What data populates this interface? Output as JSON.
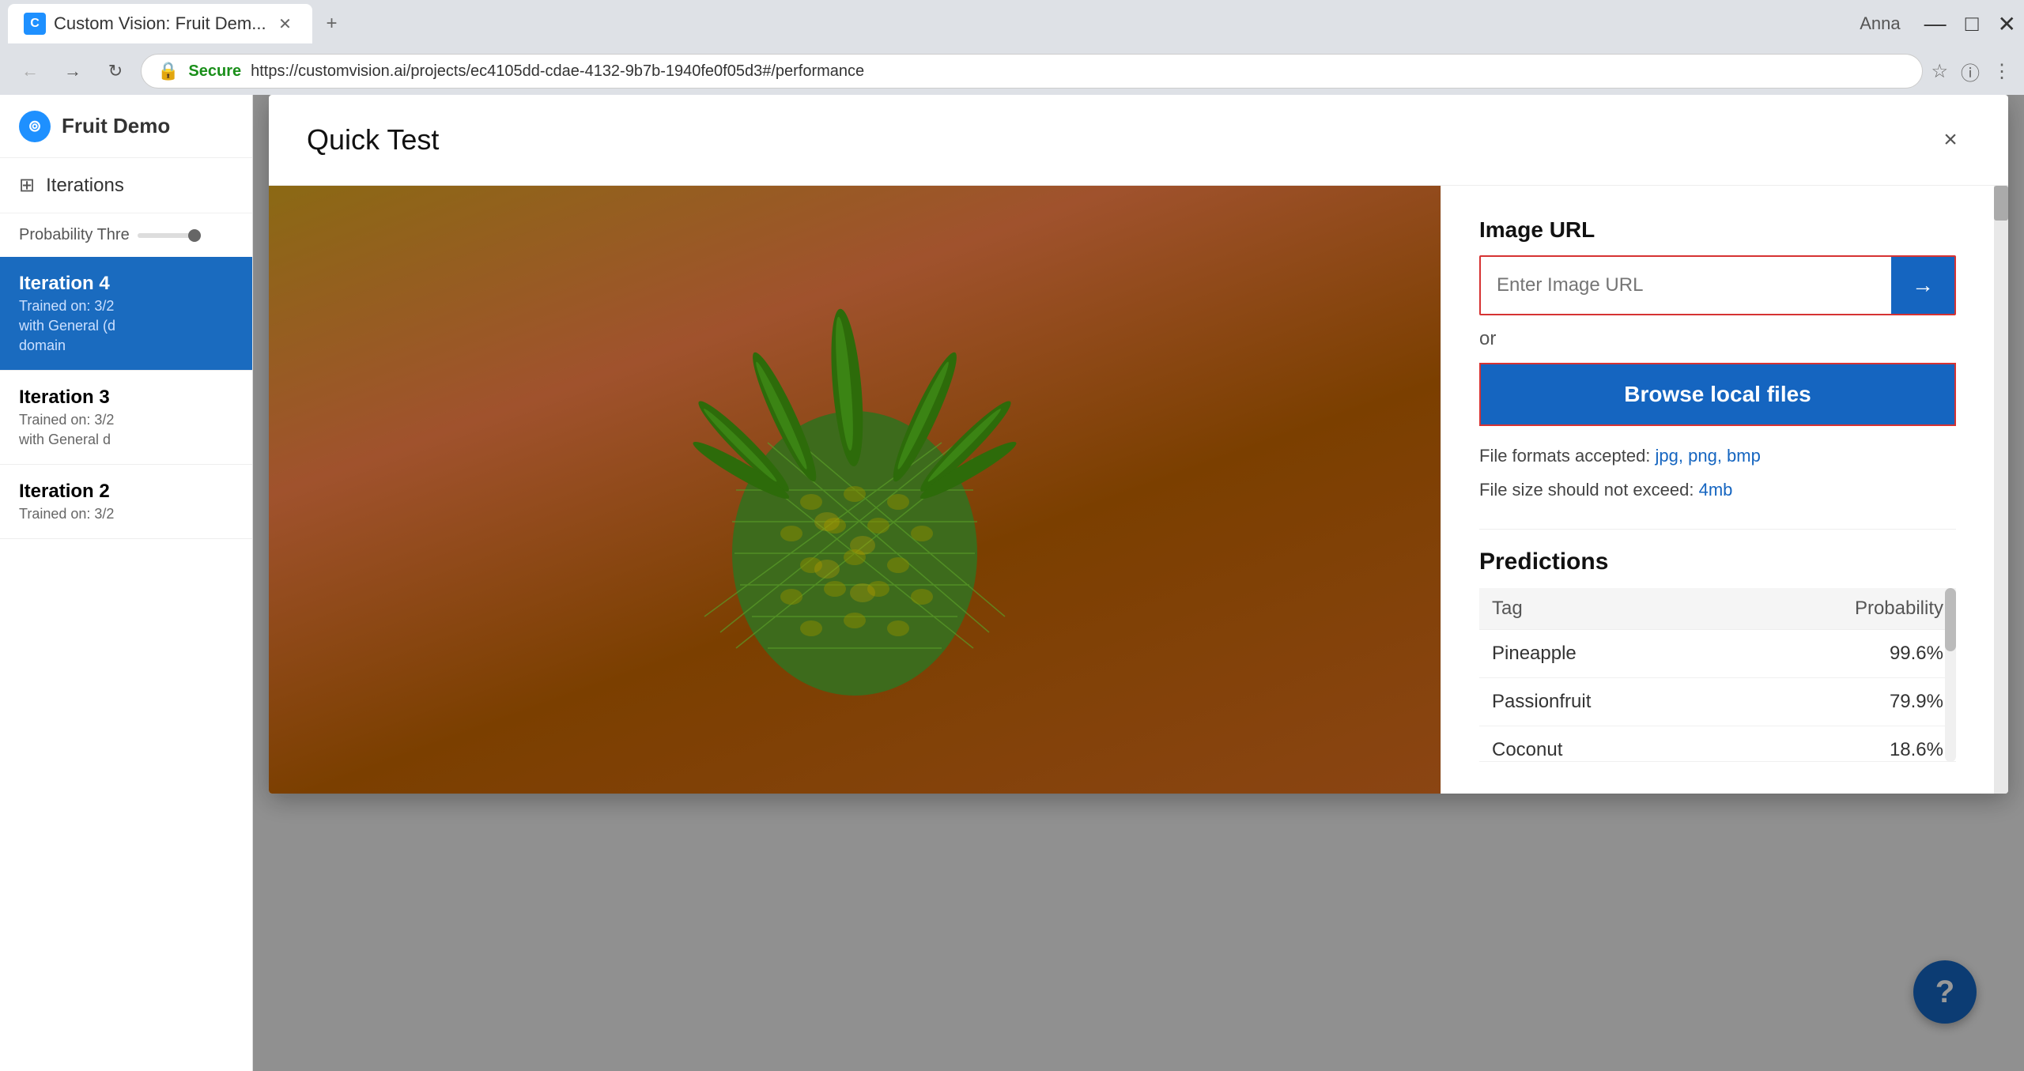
{
  "browser": {
    "tab_title": "Custom Vision: Fruit Dem...",
    "url": "https://customvision.ai/projects/ec4105dd-cdae-4132-9b7b-1940fe0f05d3#/performance",
    "secure_text": "Secure",
    "username": "Anna"
  },
  "sidebar": {
    "app_name": "Fruit Demo",
    "iterations_label": "Iterations",
    "probability_threshold_label": "Probability Thre",
    "iterations": [
      {
        "title": "Iteration 4",
        "sub1": "Trained on: 3/2",
        "sub2": "with General (d",
        "sub3": "domain",
        "active": true
      },
      {
        "title": "Iteration 3",
        "sub1": "Trained on: 3/2",
        "sub2": "with General d",
        "active": false
      },
      {
        "title": "Iteration 2",
        "sub1": "Trained on: 3/2",
        "active": false
      }
    ]
  },
  "modal": {
    "title": "Quick Test",
    "close_label": "×",
    "image_url_label": "Image URL",
    "url_input_placeholder": "Enter Image URL",
    "or_text": "or",
    "browse_button_label": "Browse local files",
    "file_formats_text": "File formats accepted: ",
    "file_formats_links": "jpg, png, bmp",
    "file_size_text": "File size should not exceed: ",
    "file_size_link": "4mb",
    "predictions_label": "Predictions",
    "table_col_tag": "Tag",
    "table_col_probability": "Probability",
    "predictions": [
      {
        "tag": "Pineapple",
        "probability": "99.6%"
      },
      {
        "tag": "Passionfruit",
        "probability": "79.9%"
      },
      {
        "tag": "Coconut",
        "probability": "18.6%"
      }
    ]
  },
  "help_button": "?",
  "icons": {
    "back": "←",
    "forward": "→",
    "refresh": "↻",
    "star": "☆",
    "info": "ⓘ",
    "menu": "⋮",
    "settings": "⚙",
    "question": "?",
    "arrow_right": "→",
    "close": "✕",
    "layers": "⊞",
    "minimize": "—",
    "maximize": "□",
    "close_win": "✕"
  }
}
